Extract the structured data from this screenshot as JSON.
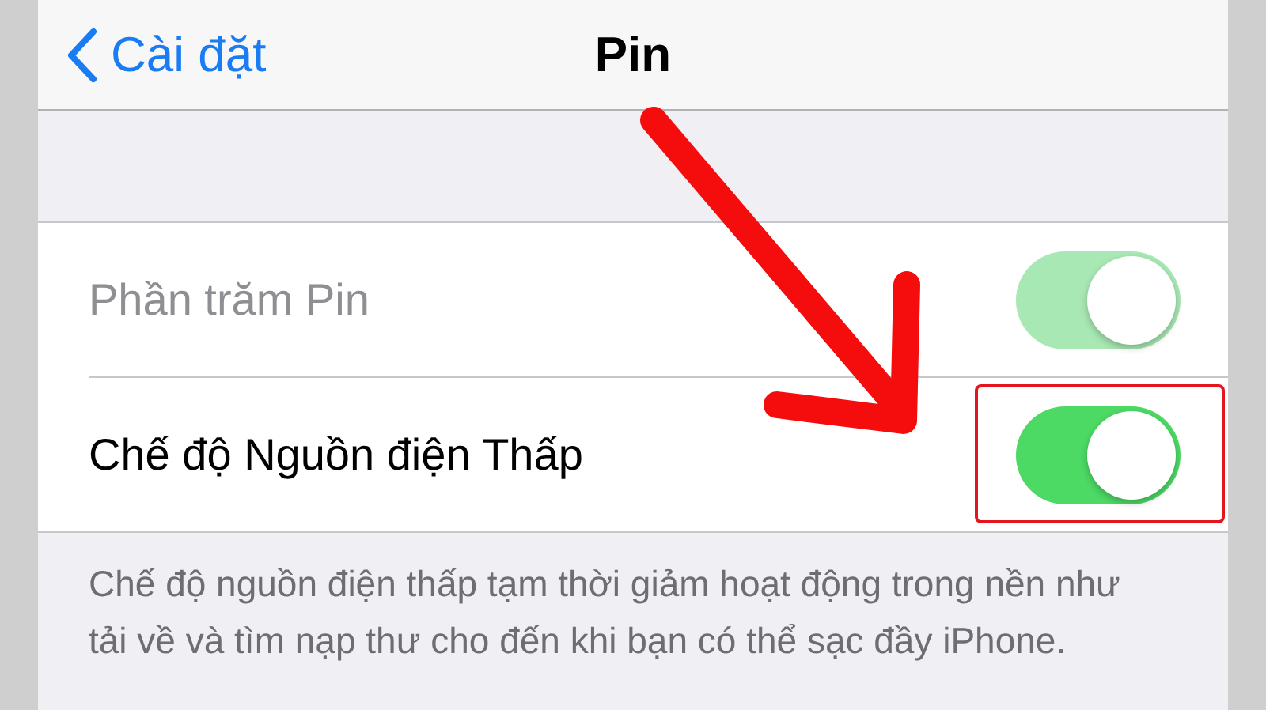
{
  "nav_bar": {
    "back_label": "Cài đặt",
    "title": "Pin"
  },
  "settings": [
    {
      "label": "Phần trăm Pin",
      "on": true,
      "disabled": true,
      "highlighted": false
    },
    {
      "label": "Chế độ Nguồn điện Thấp",
      "on": true,
      "disabled": false,
      "highlighted": true
    }
  ],
  "footer": "Chế độ nguồn điện thấp tạm thời giảm hoạt động trong nền như tải về và tìm nạp thư cho đến khi bạn có thể sạc đầy iPhone."
}
